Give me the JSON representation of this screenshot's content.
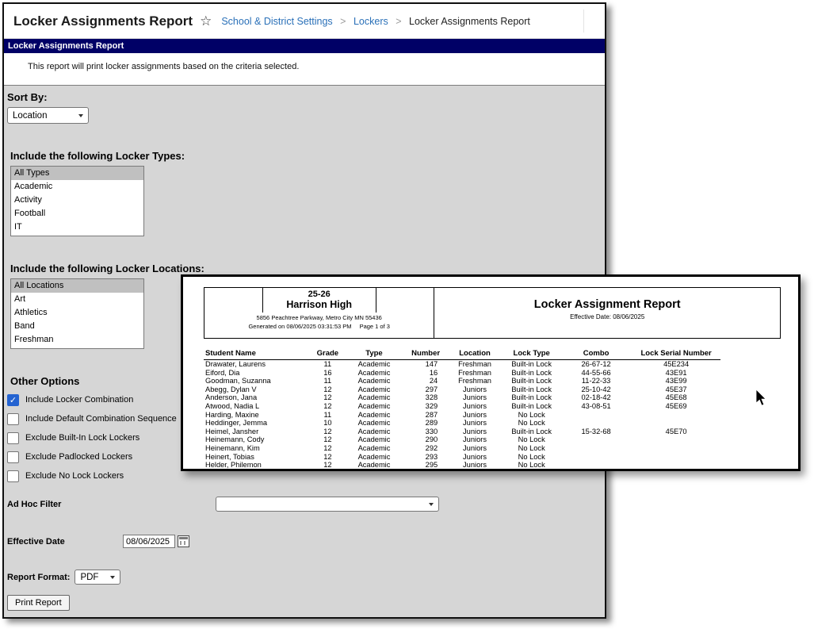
{
  "colors": {
    "header_bar": "#000066",
    "link": "#2a70b8",
    "checkbox_checked": "#2463d1",
    "form_background": "#d6d6d6",
    "selected_option": "#c0c0c0"
  },
  "header": {
    "title": "Locker Assignments Report",
    "breadcrumb": [
      "School & District Settings",
      "Lockers",
      "Locker Assignments Report"
    ]
  },
  "report_bar": {
    "title": "Locker Assignments Report"
  },
  "instruction": "This report will print locker assignments based on the criteria selected.",
  "form": {
    "sort_by": {
      "label": "Sort By:",
      "value": "Location"
    },
    "locker_types": {
      "label": "Include the following Locker Types:",
      "options": [
        {
          "label": "All Types",
          "selected": true
        },
        {
          "label": "Academic",
          "selected": false
        },
        {
          "label": "Activity",
          "selected": false
        },
        {
          "label": "Football",
          "selected": false
        },
        {
          "label": "IT",
          "selected": false
        }
      ]
    },
    "locker_locations": {
      "label": "Include the following Locker Locations:",
      "options": [
        {
          "label": "All Locations",
          "selected": true
        },
        {
          "label": "Art",
          "selected": false
        },
        {
          "label": "Athletics",
          "selected": false
        },
        {
          "label": "Band",
          "selected": false
        },
        {
          "label": "Freshman",
          "selected": false
        }
      ]
    },
    "other_options": {
      "label": "Other Options",
      "checkboxes": [
        {
          "label": "Include Locker Combination",
          "checked": true
        },
        {
          "label": "Include Default Combination Sequence",
          "checked": false
        },
        {
          "label": "Exclude Built-In Lock Lockers",
          "checked": false
        },
        {
          "label": "Exclude Padlocked Lockers",
          "checked": false
        },
        {
          "label": "Exclude No Lock Lockers",
          "checked": false
        }
      ]
    },
    "ad_hoc_filter": {
      "label": "Ad Hoc Filter",
      "value": ""
    },
    "effective_date": {
      "label": "Effective Date",
      "value": "08/06/2025"
    },
    "report_format": {
      "label": "Report Format:",
      "value": "PDF"
    },
    "print_button": "Print Report"
  },
  "report_preview": {
    "school_year": "25-26",
    "school_name": "Harrison High",
    "address": "5856 Peachtree Parkway, Metro City  MN 55436",
    "generated": "Generated on 08/06/2025 03:31:53 PM",
    "page": "Page 1 of 3",
    "title": "Locker Assignment Report",
    "subtitle": "Effective Date: 08/06/2025",
    "columns": [
      "Student Name",
      "Grade",
      "Type",
      "Number",
      "Location",
      "Lock Type",
      "Combo",
      "Lock Serial Number"
    ],
    "rows": [
      [
        "Drawater, Laurens",
        "11",
        "Academic",
        "147",
        "Freshman",
        "Built-in Lock",
        "26-67-12",
        "45E234"
      ],
      [
        "Eiford, Dia",
        "16",
        "Academic",
        "16",
        "Freshman",
        "Built-in Lock",
        "44-55-66",
        "43E91"
      ],
      [
        "Goodman, Suzanna",
        "11",
        "Academic",
        "24",
        "Freshman",
        "Built-in Lock",
        "11-22-33",
        "43E99"
      ],
      [
        "Abegg, Dylan V",
        "12",
        "Academic",
        "297",
        "Juniors",
        "Built-in Lock",
        "25-10-42",
        "45E37"
      ],
      [
        "Anderson, Jana",
        "12",
        "Academic",
        "328",
        "Juniors",
        "Built-in Lock",
        "02-18-42",
        "45E68"
      ],
      [
        "Atwood, Nadia L",
        "12",
        "Academic",
        "329",
        "Juniors",
        "Built-in Lock",
        "43-08-51",
        "45E69"
      ],
      [
        "Harding, Maxine",
        "11",
        "Academic",
        "287",
        "Juniors",
        "No Lock",
        "",
        ""
      ],
      [
        "Heddinger, Jemma",
        "10",
        "Academic",
        "289",
        "Juniors",
        "No Lock",
        "",
        ""
      ],
      [
        "Heimel, Jansher",
        "12",
        "Academic",
        "330",
        "Juniors",
        "Built-in Lock",
        "15-32-68",
        "45E70"
      ],
      [
        "Heinemann, Cody",
        "12",
        "Academic",
        "290",
        "Juniors",
        "No Lock",
        "",
        ""
      ],
      [
        "Heinemann, Kim",
        "12",
        "Academic",
        "292",
        "Juniors",
        "No Lock",
        "",
        ""
      ],
      [
        "Heinert, Tobias",
        "12",
        "Academic",
        "293",
        "Juniors",
        "No Lock",
        "",
        ""
      ],
      [
        "Helder, Philemon",
        "12",
        "Academic",
        "295",
        "Juniors",
        "No Lock",
        "",
        ""
      ]
    ]
  }
}
